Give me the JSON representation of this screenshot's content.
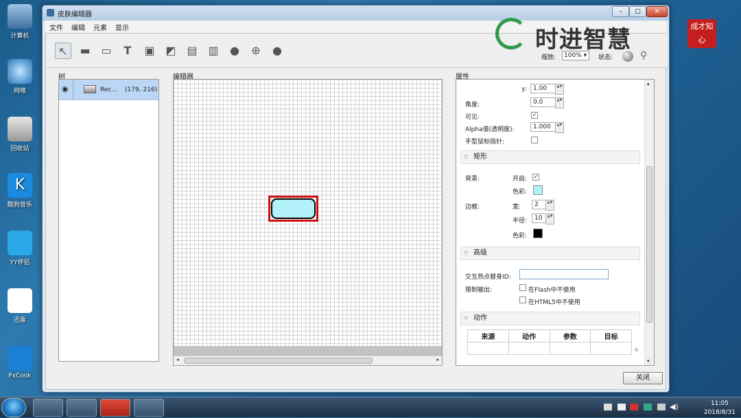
{
  "desktop": [
    "计算机",
    "网络",
    "回收站",
    "酷狗音乐",
    "YY伴侣",
    "迅雷",
    "PxCook"
  ],
  "window": {
    "title": "皮肤编辑器",
    "min": "–",
    "max": "□",
    "close": "✕"
  },
  "menu": [
    "文件",
    "编辑",
    "元素",
    "显示"
  ],
  "toolbar": {
    "zoom_label": "缩放:",
    "zoom_value": "100%",
    "state_label": "状态:"
  },
  "logo": {
    "text": "时进智慧",
    "seal": "成才知心"
  },
  "panels": {
    "tree": "树",
    "editor": "编辑器",
    "props": "属性"
  },
  "tree": {
    "item_name": "Rec...",
    "item_pos": "(179, 216)"
  },
  "props": {
    "y_label": "y:",
    "y_value": "1.00",
    "angle_label": "角度:",
    "angle_value": "0.0",
    "visible_label": "可见:",
    "alpha_label": "Alpha值(透明度):",
    "alpha_value": "1.000",
    "hand_label": "手型鼠标指针:",
    "rect_section": "矩形",
    "bg_label": "背景:",
    "on_label": "开启:",
    "color_label": "色彩:",
    "border_label": "边框:",
    "width_label": "宽:",
    "width_value": "2",
    "radius_label": "半径:",
    "radius_value": "10",
    "color2_label": "色彩:",
    "adv_section": "高级",
    "hotspot_label": "交互热点替身ID:",
    "limit_label": "限制输出:",
    "flash_label": "在Flash中不使用",
    "html5_label": "在HTML5中不使用",
    "action_section": "动作",
    "action_headers": [
      "来源",
      "动作",
      "参数",
      "目标"
    ]
  },
  "colors": {
    "bg_color": "#b3f1fb",
    "border_color": "#000000",
    "selection": "#d01010"
  },
  "close_button": "关闭",
  "clock": {
    "time": "11:05",
    "date": "2018/8/31"
  }
}
